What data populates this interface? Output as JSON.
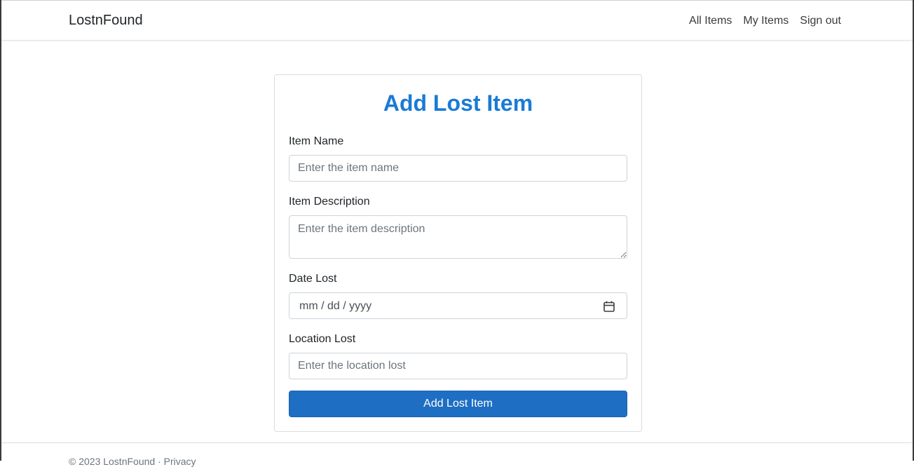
{
  "navbar": {
    "brand": "LostnFound",
    "links": [
      {
        "label": "All Items"
      },
      {
        "label": "My Items"
      },
      {
        "label": "Sign out"
      }
    ]
  },
  "form": {
    "title": "Add Lost Item",
    "item_name": {
      "label": "Item Name",
      "placeholder": "Enter the item name",
      "value": ""
    },
    "item_description": {
      "label": "Item Description",
      "placeholder": "Enter the item description",
      "value": ""
    },
    "date_lost": {
      "label": "Date Lost",
      "display": "mm / dd / yyyy",
      "icon": "calendar-icon"
    },
    "location_lost": {
      "label": "Location Lost",
      "placeholder": "Enter the location lost",
      "value": ""
    },
    "submit_label": "Add Lost Item"
  },
  "footer": {
    "text": "© 2023 LostnFound · Privacy"
  },
  "colors": {
    "accent": "#1a7bd6",
    "button": "#1e6ec3"
  }
}
